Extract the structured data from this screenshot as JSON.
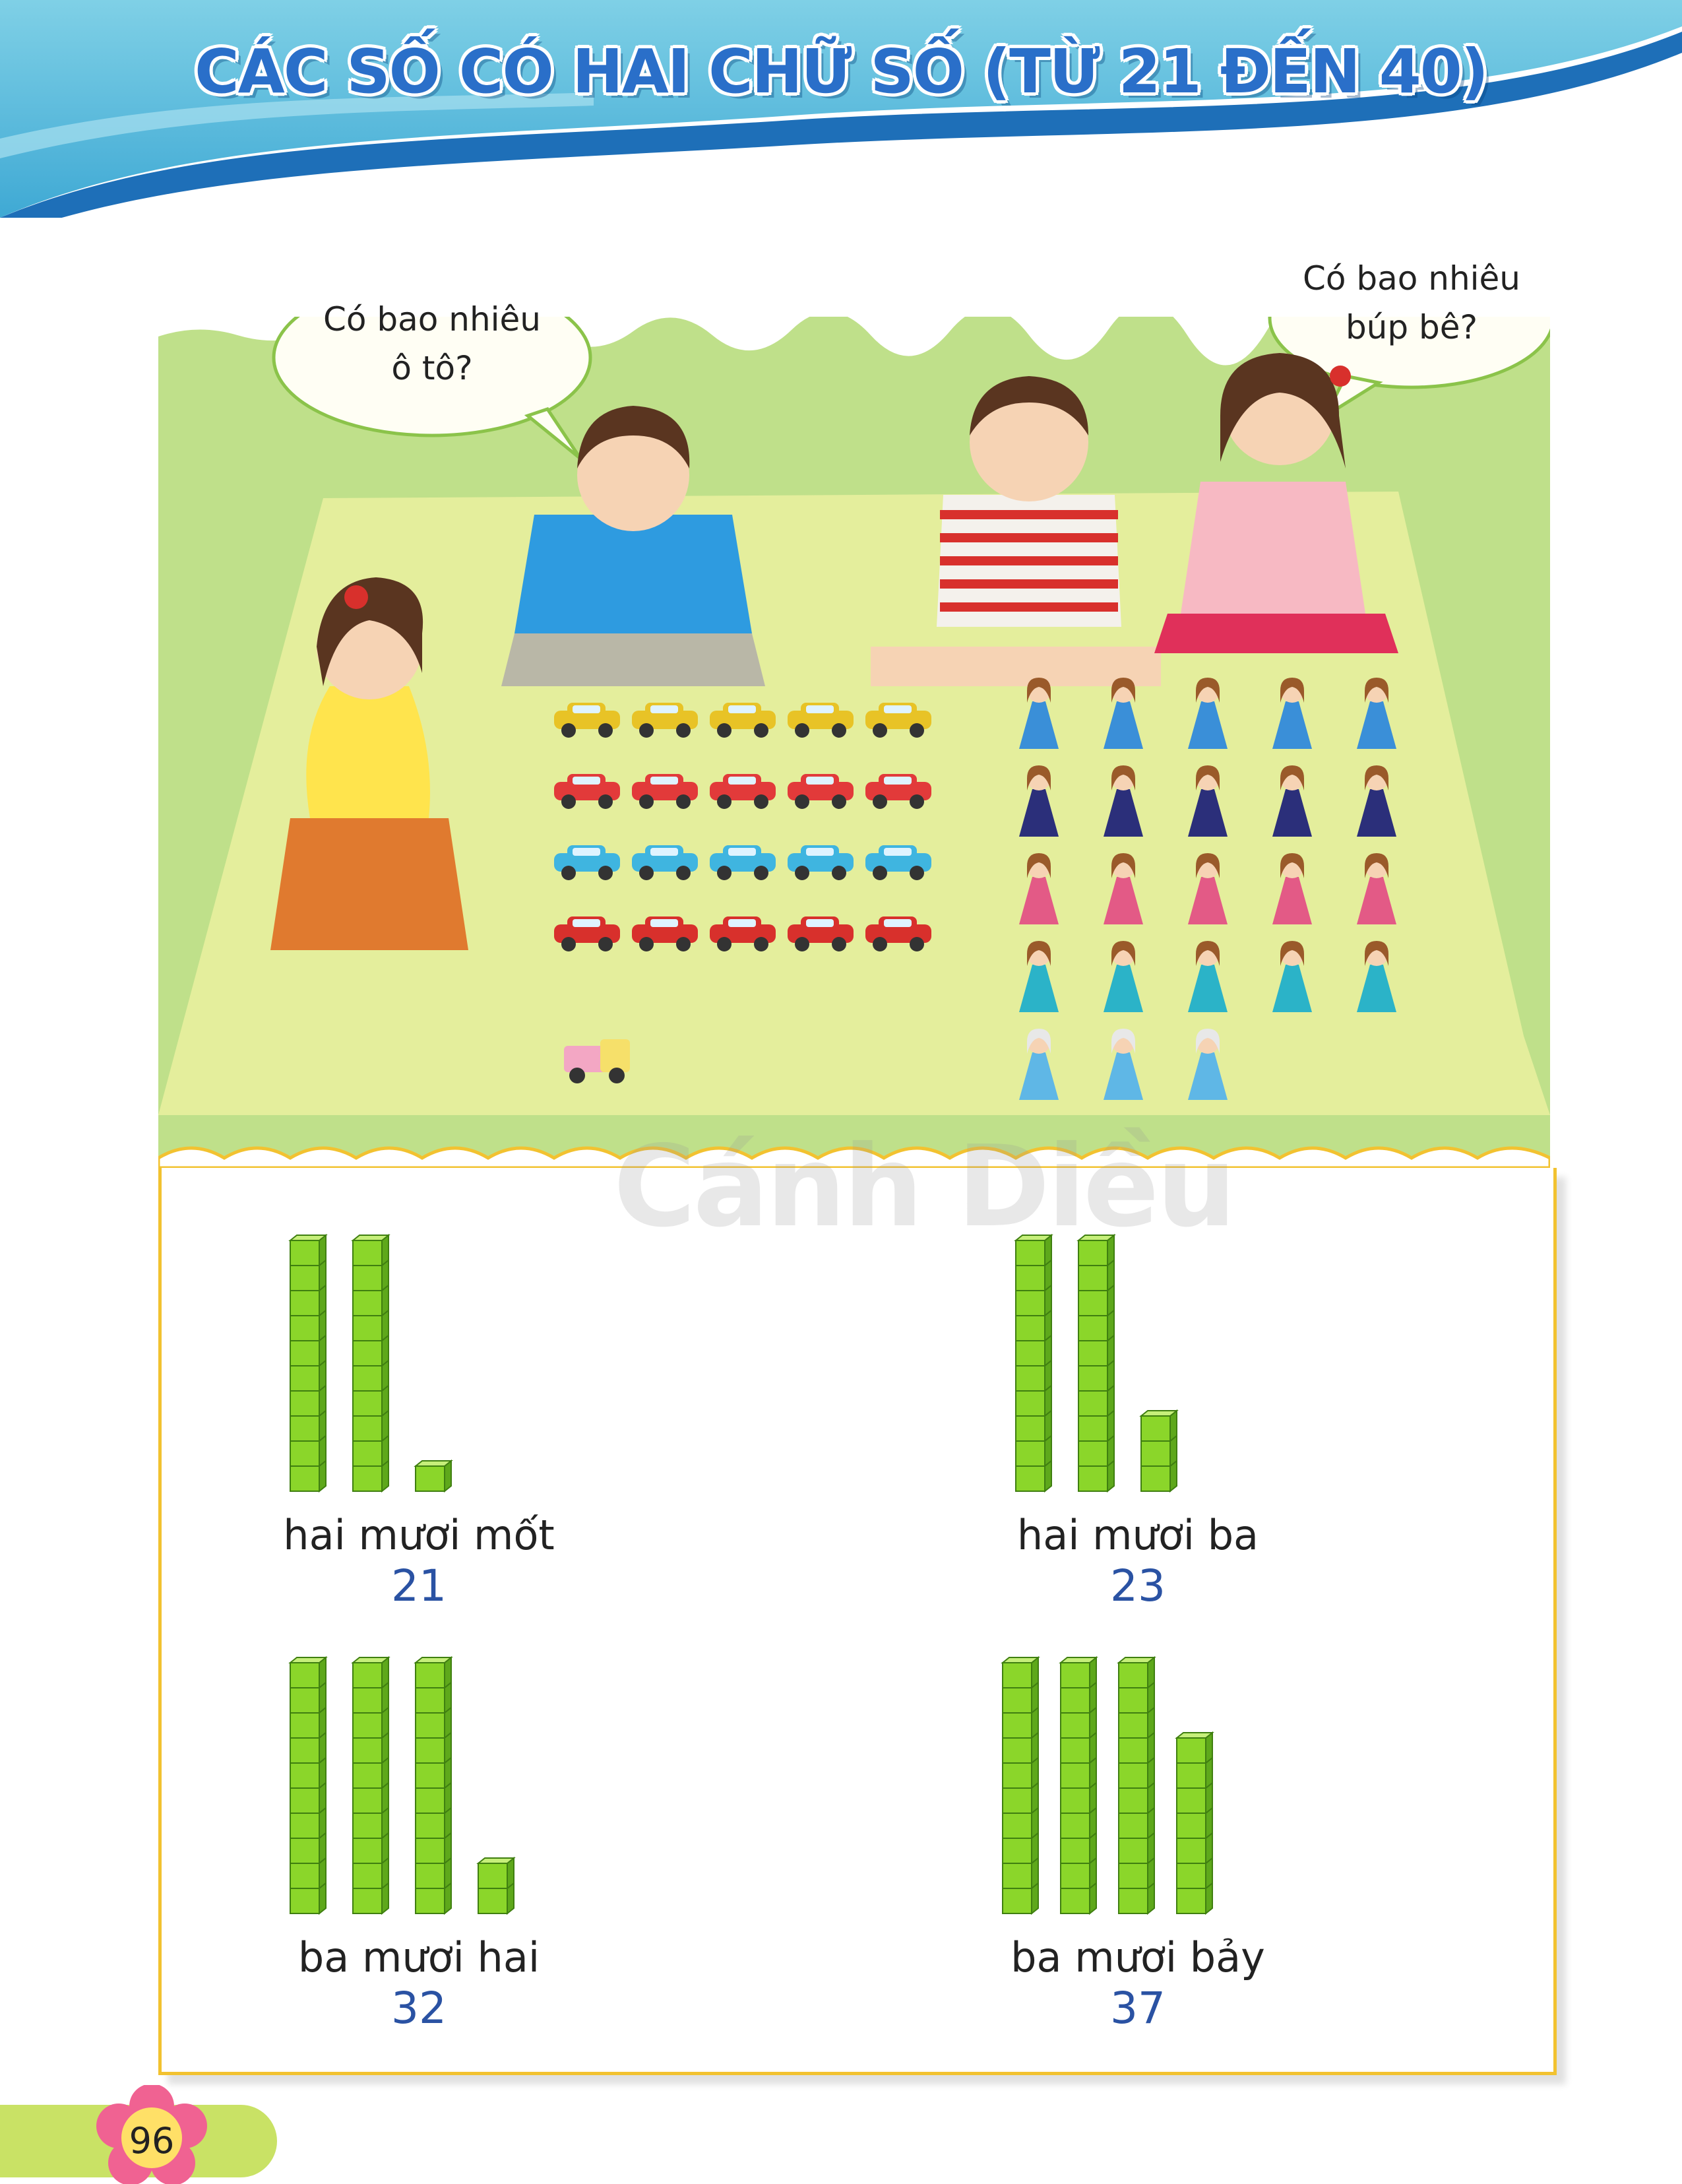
{
  "page": {
    "title": "CÁC SỐ CÓ HAI CHỮ SỐ (TỪ 21 ĐẾN 40)",
    "page_number": "96",
    "watermark": "Cánh Diều"
  },
  "scene": {
    "bubble_left": [
      "Có bao nhiêu",
      "ô tô?"
    ],
    "bubble_right": [
      "Có bao nhiêu",
      "búp bê?"
    ]
  },
  "blocks": [
    {
      "label": "hai mươi mốt",
      "number": "21",
      "tens": 2,
      "ones": 1
    },
    {
      "label": "hai mươi ba",
      "number": "23",
      "tens": 2,
      "ones": 3
    },
    {
      "label": "ba mươi hai",
      "number": "32",
      "tens": 3,
      "ones": 2
    },
    {
      "label": "ba mươi bảy",
      "number": "37",
      "tens": 3,
      "ones": 7
    }
  ],
  "colors": {
    "title": "#2a6fc9",
    "header_band": "#4bb7d9",
    "grass": "#bfe08a",
    "mat": "#e4ee9c",
    "panel_border": "#f2c230",
    "block_green": "#8bd62a",
    "number": "#2a52a3",
    "page_badge": "#c9e265",
    "flower": "#f06292"
  },
  "icons": {
    "cars": "car-icon",
    "dolls": "doll-icon",
    "truck": "toy-truck-icon",
    "flower": "flower-icon"
  }
}
